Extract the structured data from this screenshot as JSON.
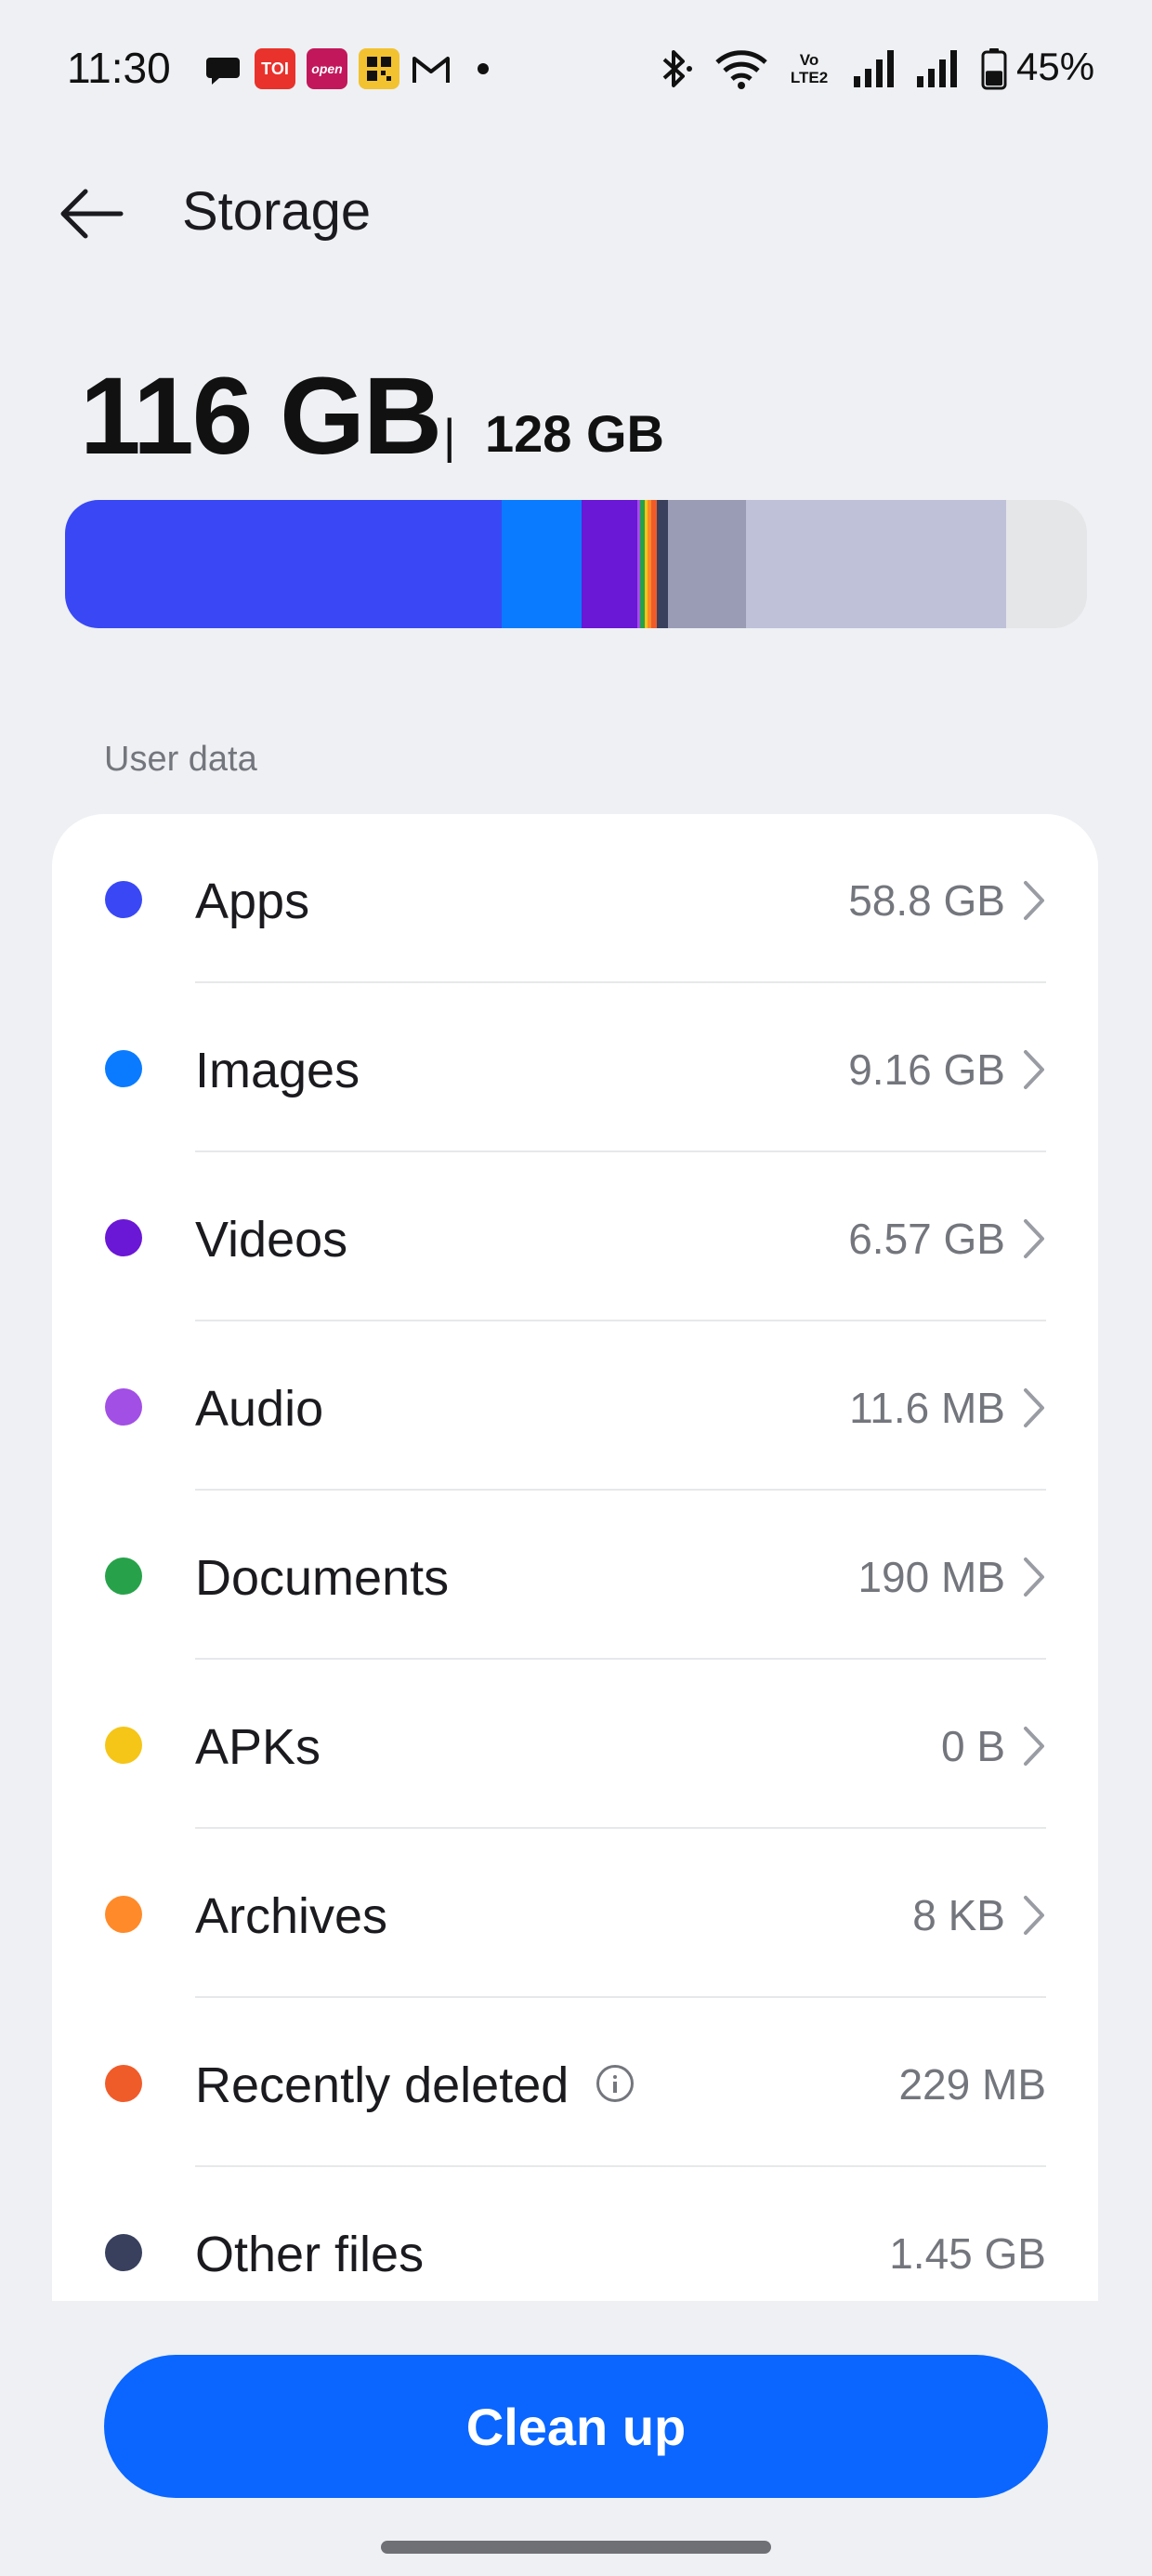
{
  "status_bar": {
    "time": "11:30",
    "notif_toi": "TOI",
    "notif_open": "open",
    "network_label_top": "Vo",
    "network_label_bottom": "LTE2",
    "battery_percent": "45%",
    "battery_level": 0.45,
    "icons": [
      "chat-icon",
      "toi-app-icon",
      "open-app-icon",
      "qr-app-icon",
      "gmail-icon",
      "more-notifications-dot",
      "bluetooth-icon",
      "wifi-icon",
      "volte-icon",
      "signal-sim1-icon",
      "signal-sim2-icon",
      "battery-icon"
    ]
  },
  "header": {
    "title": "Storage",
    "back_icon": "back-arrow-icon"
  },
  "usage": {
    "used": "116 GB",
    "separator": "|",
    "total": "128 GB"
  },
  "usage_bar": {
    "segments": [
      {
        "name": "Apps",
        "color": "#3948f4"
      },
      {
        "name": "Images",
        "color": "#0a7bff"
      },
      {
        "name": "Videos",
        "color": "#6a17d6"
      },
      {
        "name": "Audio",
        "color": "#a24fe5"
      },
      {
        "name": "Documents",
        "color": "#27a24a"
      },
      {
        "name": "APKs",
        "color": "#f5c518"
      },
      {
        "name": "Archives",
        "color": "#ff8a2a"
      },
      {
        "name": "Recently deleted",
        "color": "#f05b2a"
      },
      {
        "name": "Other files",
        "color": "#38405e"
      },
      {
        "name": "System",
        "color": "#9a9cb6"
      },
      {
        "name": "Other",
        "color": "#bfc1d8"
      },
      {
        "name": "Free",
        "color": "#e5e6e8"
      }
    ]
  },
  "section": {
    "label": "User data"
  },
  "categories": [
    {
      "label": "Apps",
      "size": "58.8 GB",
      "color": "#3948f4",
      "chevron": true
    },
    {
      "label": "Images",
      "size": "9.16 GB",
      "color": "#0a7bff",
      "chevron": true
    },
    {
      "label": "Videos",
      "size": "6.57 GB",
      "color": "#6a17d6",
      "chevron": true
    },
    {
      "label": "Audio",
      "size": "11.6 MB",
      "color": "#a24fe5",
      "chevron": true
    },
    {
      "label": "Documents",
      "size": "190 MB",
      "color": "#27a24a",
      "chevron": true
    },
    {
      "label": "APKs",
      "size": "0 B",
      "color": "#f5c518",
      "chevron": true
    },
    {
      "label": "Archives",
      "size": "8 KB",
      "color": "#ff8a2a",
      "chevron": true
    },
    {
      "label": "Recently deleted",
      "size": "229 MB",
      "color": "#f05b2a",
      "chevron": false,
      "info_icon": true
    },
    {
      "label": "Other files",
      "size": "1.45 GB",
      "color": "#38405e",
      "chevron": false
    }
  ],
  "footer": {
    "cleanup_label": "Clean up",
    "cleanup_color": "#0a66ff"
  }
}
